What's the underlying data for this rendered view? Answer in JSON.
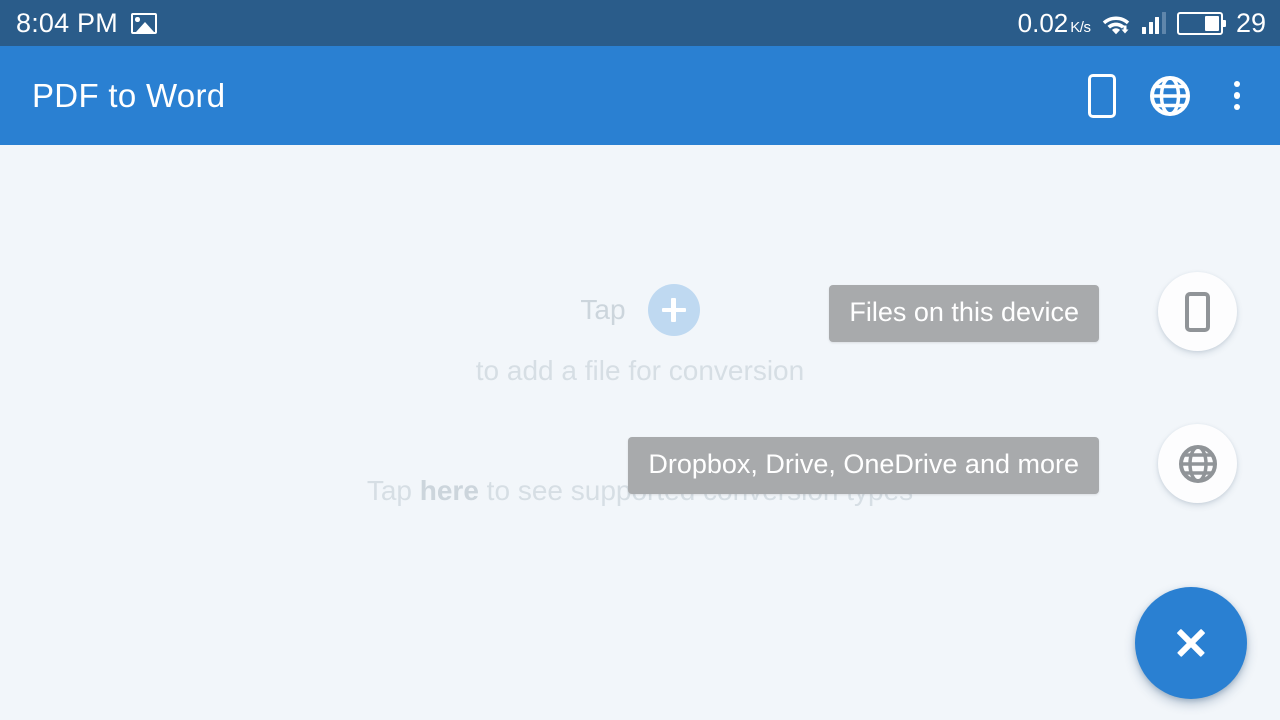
{
  "status_bar": {
    "time": "8:04 PM",
    "notification_icon": "photo-icon",
    "network_speed": "0.02",
    "network_speed_unit": "K/s",
    "wifi_icon": "wifi-icon",
    "signal_icon": "signal-bars-icon",
    "battery_icon": "battery-icon",
    "battery_level": "29",
    "background_color": "#2a5c8a"
  },
  "app_bar": {
    "title": "PDF to Word",
    "background_color": "#2a80d2",
    "actions": [
      {
        "name": "device-files-action",
        "icon": "phone-device-icon"
      },
      {
        "name": "cloud-files-action",
        "icon": "globe-icon"
      },
      {
        "name": "overflow-menu-action",
        "icon": "more-vertical-icon"
      }
    ]
  },
  "main": {
    "hint_tap": "Tap",
    "plus_icon": "plus-circle-icon",
    "hint_add_file": "to add a file for conversion",
    "hint_types_prefix": "Tap ",
    "hint_types_bold": "here",
    "hint_types_suffix": " to see supported conversion types",
    "hint_text_color": "#d6dee4",
    "background_color": "#f2f6fa"
  },
  "speed_dial": {
    "expanded": true,
    "label_color": "#a8aaac",
    "fab_color": "#2a80d2",
    "items": [
      {
        "label": "Files on this device",
        "icon": "phone-device-icon"
      },
      {
        "label": "Dropbox, Drive, OneDrive and more",
        "icon": "globe-icon"
      }
    ],
    "main_fab_icon": "close-x-icon"
  }
}
